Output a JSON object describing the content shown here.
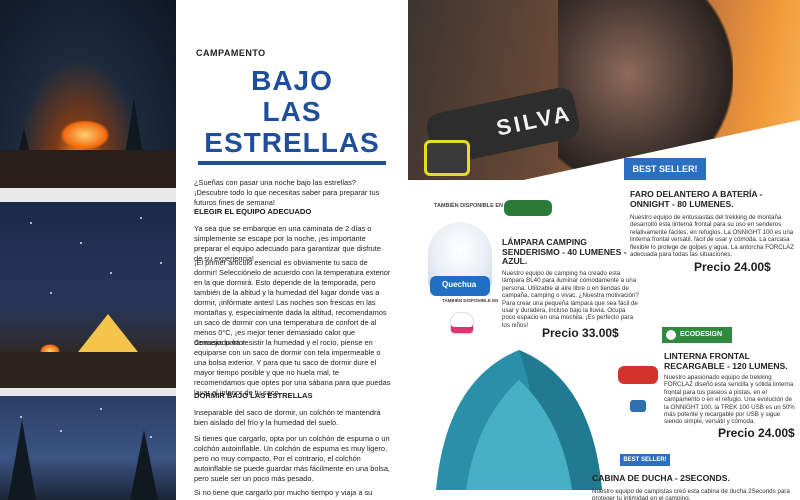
{
  "article": {
    "kicker": "CAMPAMENTO",
    "title_lines": [
      "BAJO",
      "LAS",
      "ESTRELLAS"
    ],
    "intro": "¿Sueñas con pasar una noche bajo las estrellas? ¡Descubre todo lo que necesitas saber para preparar tus futuros fines de semana!",
    "section1_heading": "ELEGIR EL EQUIPO ADECUADO",
    "p1": "Ya sea que se embarque en una caminata de 2 días o simplemente se escape por la noche, ¡es importante preparar el equipo adecuado para garantizar que disfrute de su experiencia!",
    "p2": "¡El primer artículo esencial es obviamente tu saco de dormir! Selecciónelo de acuerdo con la temperatura exterior en la que dormirá. Esto depende de la temporada, pero también de la altitud y la humedad del lugar donde vas a dormir, ¡infórmate antes! Las noches son frescas en las montañas y, especialmente dada la altitud, recomendamos un saco de dormir con una temperatura de confort de al menos 0°C, ¡es mejor tener demasiado calor que demasiado frío!",
    "p3": "Consejo: para resistir la humedad y el rocío, piense en equiparse con un saco de dormir con tela impermeable o una bolsa exterior. Y para que tu saco de dormir dure el mayor tiempo posible y que no huela mal, te recomendamos que optes por una sábana para que puedas lavar el interior de tu saco.",
    "section2_heading": "DORMIR BAJO LAS ESTRELLAS",
    "p4": "Inseparable del saco de dormir, un colchón te mantendrá bien aislado del frío y la humedad del suelo.",
    "p5": "Si tienes que cargarlo, opta por un colchón de espuma o un colchón autoinflable. Un colchón de espuma es muy ligero, pero no muy compacto. Por el contrario, el colchón autoinflable se puede guardar más fácilmente en una bolsa, pero suele ser un poco más pesado.",
    "p6": "Si no tiene que cargarlo por mucho tiempo y viaja a su"
  },
  "catalog": {
    "hero_brand": "SILVA",
    "p1": {
      "badge": "BEST SELLER!",
      "title": "FARO DELANTERO A BATERÍA - ONNIGHT - 80 LUMENES.",
      "desc": "Nuestro equipo de entusiastas del trekking de montaña desarrolló esta linterna frontal para su uso en senderos relativamente fáciles, en refugios. La ONNIGHT 100 es una linterna frontal versátil, fácil de usar y cómoda. La carcasa flexible lo protege de golpes y agua. La antorcha FORCLAZ adecuada para todas las situaciones.",
      "price": "Precio 24.00$"
    },
    "p2": {
      "available_label": "TAMBIÉN DISPONIBLE EN",
      "available_label_small": "TAMBIÉN DISPONIBLE EN",
      "lantern_brand": "Quechua",
      "title": "LÁMPARA CAMPING SENDERISMO - 40 LUMENES - AZUL.",
      "desc": "Nuestro equipo de camping ha creado esta lámpara BL40 para iluminar cómodamente a una persona. Utilizable al aire libre o en tiendas de campaña, camping o vivac. ¿Nuestra motivación? Para crear una pequeña lámpara que sea fácil de usar y duradera, incluso bajo la lluvia. Ocupa poco espacio en una mochila. ¡Es perfecto para los niños!",
      "price": "Precio 33.00$"
    },
    "p3": {
      "eco_badge": "ECODESIGN",
      "title": "LINTERNA FRONTAL RECARGABLE - 120 LUMENS.",
      "desc": "Nuestro apasionado equipo de trekking FORCLAZ diseñó esta sencilla y sólida linterna frontal para tus paseos a pistas, en el campamento o en el refugio. Una evolución de la ONNIGHT 100, la TREK 100 USB es un 50% más potente y recargable por USB y sigue siendo simple, versátil y cómoda.",
      "price": "Precio 24.00$"
    },
    "p4": {
      "badge": "BEST SELLER!",
      "title": "CABINA DE DUCHA - 2SECONDS.",
      "desc": "Nuestro equipo de campistas creó esta cabina de ducha 2Seconds para proteger tu intimidad en el camping."
    }
  },
  "colors": {
    "accent_blue": "#1f4e9a",
    "badge_blue": "#2a6fc0",
    "eco_green": "#2e8a3d"
  }
}
